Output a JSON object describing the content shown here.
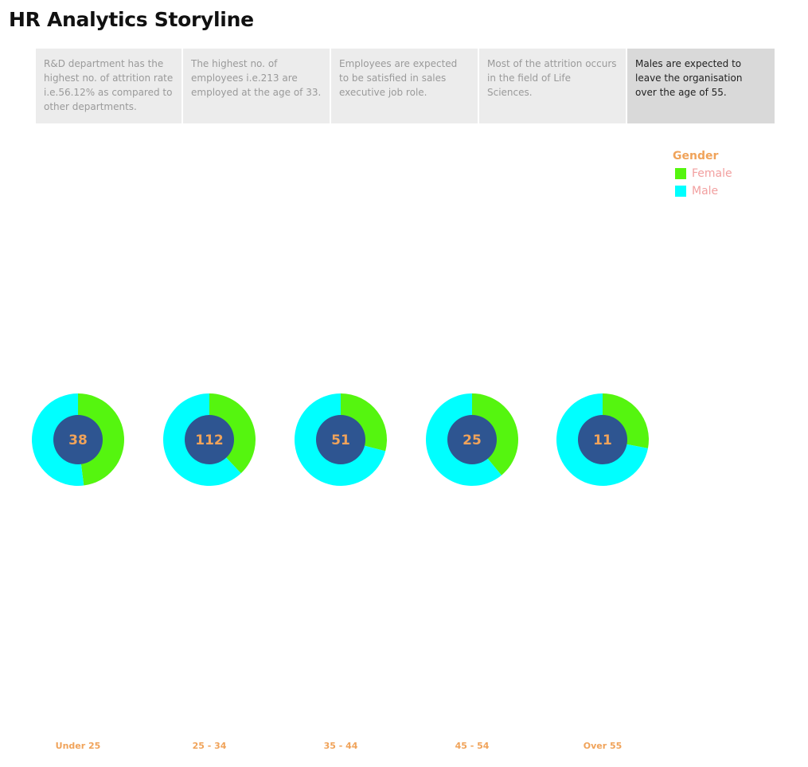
{
  "title": "HR Analytics Storyline",
  "story_points": [
    {
      "text": "R&D department has the highest no. of attrition rate i.e.56.12% as compared to other departments."
    },
    {
      "text": "The highest no. of employees i.e.213 are employed at the age of  33."
    },
    {
      "text": "Employees are expected to be satisfied in sales executive job role."
    },
    {
      "text": "Most of the attrition occurs in the field of Life Sciences."
    },
    {
      "text": "Males are expected to leave the organisation over the age of 55.",
      "active": true
    }
  ],
  "legend": {
    "title": "Gender",
    "items": [
      {
        "label": "Female",
        "color": "#55f50f"
      },
      {
        "label": "Male",
        "color": "#00ffff"
      }
    ]
  },
  "chart_data": {
    "type": "donut",
    "categories": [
      "Under 25",
      "25 - 34",
      "35 - 44",
      "45 - 54",
      "Over 55"
    ],
    "totals": [
      38,
      112,
      51,
      25,
      11
    ],
    "series": [
      {
        "name": "Female",
        "color": "#55f50f",
        "share": [
          0.48,
          0.38,
          0.29,
          0.39,
          0.28
        ]
      },
      {
        "name": "Male",
        "color": "#00ffff",
        "share": [
          0.52,
          0.62,
          0.71,
          0.61,
          0.72
        ]
      }
    ],
    "center_color": "#2e5591"
  }
}
